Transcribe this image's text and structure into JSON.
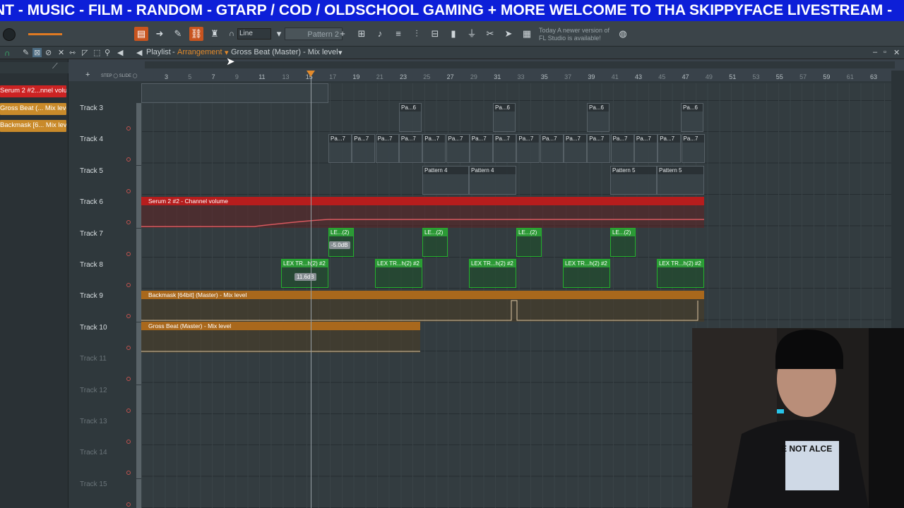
{
  "banner": {
    "text": "NT - MUSIC - FILM - RANDOM - GTARP / COD / OLDSCHOOL GAMING + MORE WELCOME TO THA SKIPPYFACE LIVESTREAM -"
  },
  "toolbar": {
    "snap_value": "Line",
    "pattern_selector": "Pattern 2",
    "hint_line1": "Today  A newer version of",
    "hint_line2": "FL Studio is available!"
  },
  "titlebar": {
    "window": "Playlist",
    "separator": "-",
    "view": "Arrangement",
    "clip_source": "Gross Beat (Master) - Mix level"
  },
  "sidebar": {
    "items": [
      {
        "label": "Serum 2 #2...nnel volume",
        "color": "#cc2323"
      },
      {
        "label": "Gross Beat (... Mix level",
        "color": "#c98a2a"
      },
      {
        "label": "Backmask [6... Mix level",
        "color": "#c98a2a"
      }
    ]
  },
  "ruler": {
    "bars": [
      "3",
      "5",
      "7",
      "9",
      "11",
      "13",
      "15",
      "17",
      "19",
      "21",
      "23",
      "25",
      "27",
      "29",
      "31",
      "33",
      "35",
      "37",
      "39",
      "41",
      "43",
      "45",
      "47",
      "49",
      "51",
      "53",
      "55",
      "57",
      "59",
      "61",
      "63"
    ]
  },
  "tracks": [
    "Track 3",
    "Track 4",
    "Track 5",
    "Track 6",
    "Track 7",
    "Track 8",
    "Track 9",
    "Track 10",
    "Track 11",
    "Track 12",
    "Track 13",
    "Track 14",
    "Track 15"
  ],
  "clips": {
    "track3": [
      "Pa...6",
      "Pa...6",
      "Pa...6",
      "Pa...6"
    ],
    "track4": [
      "Pa...7",
      "Pa...7",
      "Pa...7",
      "Pa...7",
      "Pa...7",
      "Pa...7",
      "Pa...7",
      "Pa...7",
      "Pa...7",
      "Pa...7",
      "Pa...7",
      "Pa...7",
      "Pa...7",
      "Pa...7",
      "Pa...7",
      "Pa...7"
    ],
    "track5": [
      "Pattern 4",
      "Pattern 4",
      "Pattern 5",
      "Pattern 5"
    ],
    "track6": "Serum 2 #2 - Channel volume",
    "track7": [
      "LE...(2)",
      "LE...(2)",
      "LE...(2)",
      "LE...(2)"
    ],
    "track7_tooltip": "-5.0dB",
    "track8": [
      "LEX TR...h(2) #2",
      "LEX TR...h(2) #2",
      "LEX TR...h(2) #2",
      "LEX TR...h(2) #2",
      "LEX TR...h(2) #2"
    ],
    "track8_tooltip": "11.6dB",
    "track9": "Backmask [64bit] (Master) - Mix level",
    "track10": "Gross Beat (Master) - Mix level"
  },
  "colors": {
    "accent": "#e38a2b",
    "banner": "#0d1fd8",
    "green_clip": "#23b22c",
    "red_auto": "#b61d1d",
    "orange_auto": "#a9681c"
  },
  "webcam": {
    "shirt_text": "E NOT ALCE"
  }
}
